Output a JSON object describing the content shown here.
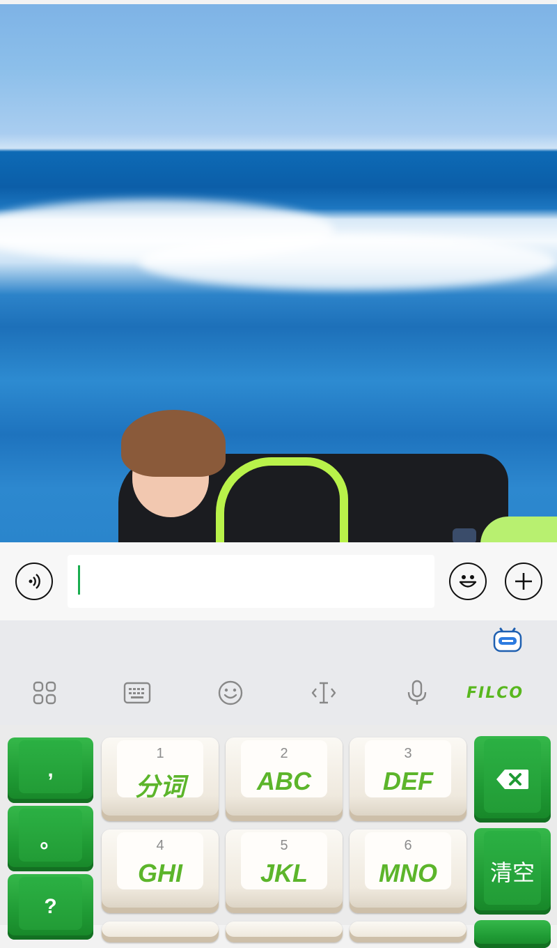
{
  "input_bar": {
    "voice_icon": "voice-input-icon",
    "emoji_icon": "smiley-icon",
    "plus_icon": "plus-icon",
    "text_value": ""
  },
  "toolbar": {
    "icons": [
      "apps-grid-icon",
      "keyboard-icon",
      "emoji-icon",
      "text-cursor-icon",
      "microphone-icon"
    ],
    "brand": "FILCO",
    "brand_color": "#58b71e"
  },
  "keyboard": {
    "left_keys": [
      ",",
      "。",
      "?"
    ],
    "keys": [
      {
        "num": "1",
        "label": "分词"
      },
      {
        "num": "2",
        "label": "ABC"
      },
      {
        "num": "3",
        "label": "DEF"
      },
      {
        "num": "4",
        "label": "GHI"
      },
      {
        "num": "5",
        "label": "JKL"
      },
      {
        "num": "6",
        "label": "MNO"
      }
    ],
    "clear_label": "清空",
    "accent_green": "#229c36",
    "letter_color": "#5cb52b"
  }
}
